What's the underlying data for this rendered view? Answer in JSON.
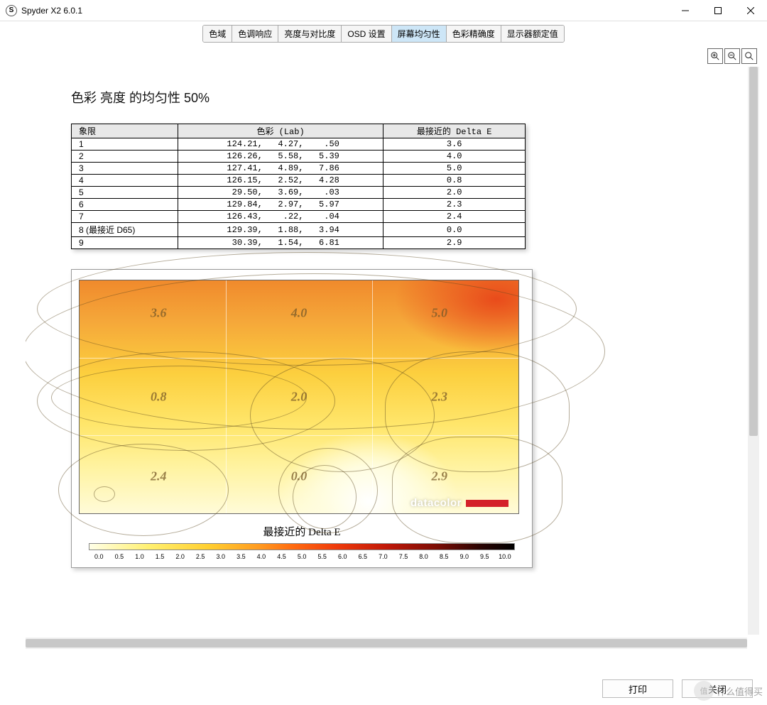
{
  "window": {
    "title": "Spyder X2 6.0.1"
  },
  "tabs": {
    "items": [
      "色域",
      "色调响应",
      "亮度与对比度",
      "OSD 设置",
      "屏幕均匀性",
      "色彩精确度",
      "显示器额定值"
    ],
    "active_index": 4
  },
  "page": {
    "title": "色彩 亮度 的均匀性 50%",
    "table": {
      "headers": {
        "quadrant": "象限",
        "lab": "色彩 (Lab)",
        "delta_e": "最接近的 Delta E"
      },
      "rows": [
        {
          "q": "1",
          "lab": " 124.21,   4.27,    .50",
          "de": "3.6"
        },
        {
          "q": "2",
          "lab": " 126.26,   5.58,   5.39",
          "de": "4.0"
        },
        {
          "q": "3",
          "lab": " 127.41,   4.89,   7.86",
          "de": "5.0"
        },
        {
          "q": "4",
          "lab": " 126.15,   2.52,   4.28",
          "de": "0.8"
        },
        {
          "q": "5",
          "lab": "  29.50,   3.69,    .03",
          "de": "2.0"
        },
        {
          "q": "6",
          "lab": " 129.84,   2.97,   5.97",
          "de": "2.3"
        },
        {
          "q": "7",
          "lab": " 126.43,    .22,    .04",
          "de": "2.4"
        },
        {
          "q": "8 (最接近 D65)",
          "lab": " 129.39,   1.88,   3.94",
          "de": "0.0"
        },
        {
          "q": "9",
          "lab": "  30.39,   1.54,   6.81",
          "de": "2.9"
        }
      ]
    },
    "heatmap": {
      "legend_title": "最接近的 Delta E",
      "brand": "datacolor",
      "grid_values": [
        [
          "3.6",
          "4.0",
          "5.0"
        ],
        [
          "0.8",
          "2.0",
          "2.3"
        ],
        [
          "2.4",
          "0.0",
          "2.9"
        ]
      ],
      "legend_ticks": [
        "0.0",
        "0.5",
        "1.0",
        "1.5",
        "2.0",
        "2.5",
        "3.0",
        "3.5",
        "4.0",
        "4.5",
        "5.0",
        "5.5",
        "6.0",
        "6.5",
        "7.0",
        "7.5",
        "8.0",
        "8.5",
        "9.0",
        "9.5",
        "10.0"
      ]
    }
  },
  "footer": {
    "print": "打印",
    "close": "关闭"
  },
  "watermark": {
    "text": "什么值得买",
    "badge": "值"
  },
  "chart_data": {
    "type": "heatmap",
    "title": "最接近的 Delta E",
    "xlabel": "",
    "ylabel": "",
    "grid": [
      [
        3.6,
        4.0,
        5.0
      ],
      [
        0.8,
        2.0,
        2.3
      ],
      [
        2.4,
        0.0,
        2.9
      ]
    ],
    "rows": 3,
    "cols": 3,
    "colorbar_range": [
      0.0,
      10.0
    ],
    "colorbar_ticks": [
      0.0,
      0.5,
      1.0,
      1.5,
      2.0,
      2.5,
      3.0,
      3.5,
      4.0,
      4.5,
      5.0,
      5.5,
      6.0,
      6.5,
      7.0,
      7.5,
      8.0,
      8.5,
      9.0,
      9.5,
      10.0
    ]
  }
}
